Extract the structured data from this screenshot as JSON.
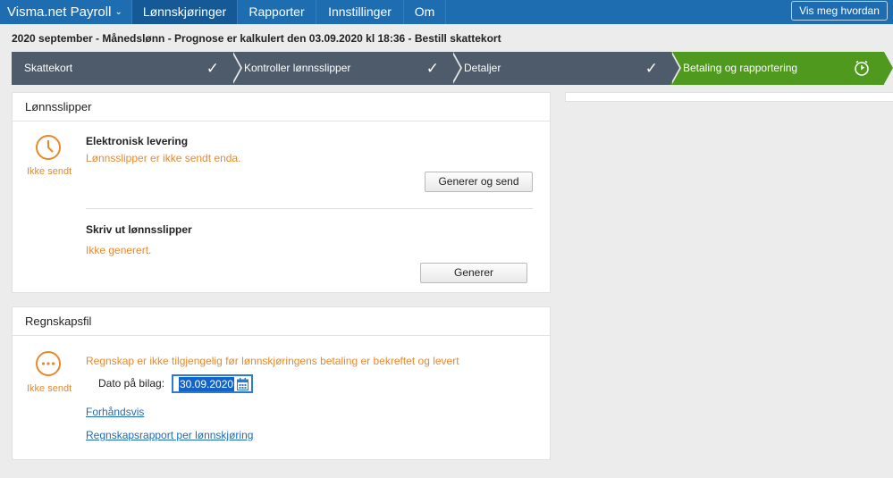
{
  "topnav": {
    "brand": "Visma.net Payroll",
    "tabs": [
      {
        "label": "Lønnskjøringer",
        "active": true
      },
      {
        "label": "Rapporter"
      },
      {
        "label": "Innstillinger"
      },
      {
        "label": "Om"
      }
    ],
    "help_button": "Vis meg hvordan"
  },
  "run_title": "2020 september - Månedslønn - Prognose er kalkulert den 03.09.2020 kl 18:36 - Bestill skattekort",
  "steps": [
    {
      "label": "Skattekort",
      "state": "done"
    },
    {
      "label": "Kontroller lønnsslipper",
      "state": "done"
    },
    {
      "label": "Detaljer",
      "state": "done"
    },
    {
      "label": "Betaling og rapportering",
      "state": "active"
    }
  ],
  "payslips": {
    "title": "Lønnsslipper",
    "status_label": "Ikke sendt",
    "electronic": {
      "title": "Elektronisk levering",
      "message": "Lønnsslipper er ikke sendt enda.",
      "button": "Generer og send"
    },
    "print": {
      "title": "Skriv ut lønnsslipper",
      "message": "Ikke generert.",
      "button": "Generer"
    }
  },
  "accounting": {
    "title": "Regnskapsfil",
    "status_label": "Ikke sendt",
    "message": "Regnskap er ikke tilgjengelig før lønnskjøringens betaling er bekreftet og levert",
    "date_label": "Dato på bilag:",
    "date_value": "30.09.2020",
    "preview_link": "Forhåndsvis",
    "report_link": "Regnskapsrapport per lønnskjøring"
  },
  "colors": {
    "nav": "#1e6db1",
    "step_done": "#4d5b6a",
    "step_active": "#4f9a1e",
    "warning": "#e8892a",
    "link": "#1f6bb5"
  }
}
